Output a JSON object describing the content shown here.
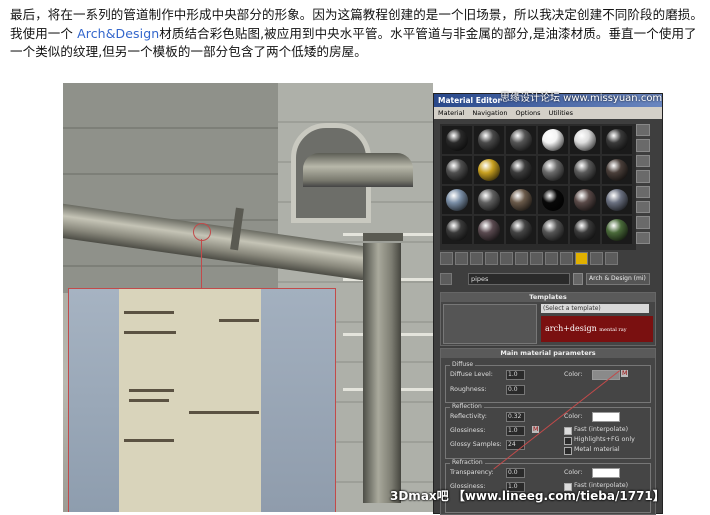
{
  "paragraph": {
    "part1": "最后，将在一系列的管道制作中形成中央部分的形象。因为这篇教程创建的是一个旧场景，所以我决定创建不同阶段的磨损。我使用一个 ",
    "highlight": "Arch&Design",
    "part2": "材质结合彩色贴图,被应用到中央水平管。水平管道与非金属的部分,是油漆材质。垂直一个使用了一个类似的纹理,但另一个模板的一部分包含了两个低矮的房屋。"
  },
  "material_editor": {
    "title": "Material Editor",
    "menus": [
      "Material",
      "Navigation",
      "Options",
      "Utilities"
    ],
    "material_name": "pipes",
    "material_type": "Arch & Design (mi)",
    "templates": {
      "header": "Templates",
      "select_placeholder": "(Select a template)",
      "banner_text": "arch+design",
      "banner_sub": "mental ray"
    },
    "main_params": {
      "header": "Main material parameters",
      "diffuse": {
        "title": "Diffuse",
        "level_label": "Diffuse Level:",
        "level_value": "1.0",
        "roughness_label": "Roughness:",
        "roughness_value": "0.0",
        "color_label": "Color:",
        "color_swatch": "#8a8a8a",
        "map_button": "M"
      },
      "reflection": {
        "title": "Reflection",
        "reflectivity_label": "Reflectivity:",
        "reflectivity_value": "0.32",
        "glossiness_label": "Glossiness:",
        "glossiness_value": "1.0",
        "glossy_label": "Glossy Samples:",
        "glossy_value": "24",
        "color_label": "Color:",
        "map_button": "M",
        "opt_fast": "Fast (interpolate)",
        "opt_highlights": "Highlights+FG only",
        "opt_metal": "Metal material"
      },
      "refraction": {
        "title": "Refraction",
        "transparency_label": "Transparency:",
        "transparency_value": "0.0",
        "glossiness_label": "Glossiness:",
        "glossiness_value": "1.0",
        "color_label": "Color:",
        "opt_fast": "Fast (interpolate)"
      }
    },
    "slot_colors": [
      "#2a2a2a",
      "#4a4a4a",
      "#555",
      "#f4f4f4",
      "#dcdcdc",
      "#3a3a3a",
      "#505050",
      "#c8a020",
      "#3c3c3c",
      "#6a6a6a",
      "#5a5a5a",
      "#4a3f3a",
      "#7a8ea6",
      "#606060",
      "#6a5a4a",
      "#080808",
      "#5a4a48",
      "#6a7080",
      "#3a3a3a",
      "#5a4a50",
      "#444",
      "#555",
      "#3a3a3a",
      "#4a6a3a"
    ]
  },
  "watermark_brand": "思缘设计论坛 www.missyuan.com",
  "watermark_url": "3Dmax吧 【www.lineeg.com/tieba/1771】"
}
